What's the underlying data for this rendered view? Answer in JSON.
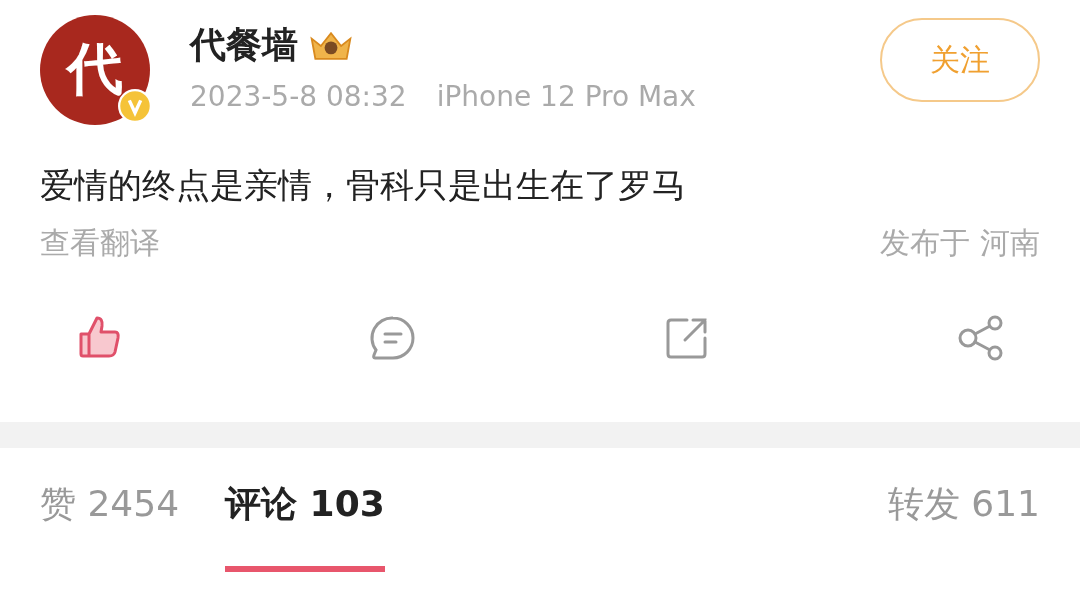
{
  "author": {
    "avatar_text": "代",
    "name": "代餐墙",
    "verified": true,
    "time": "2023-5-8 08:32",
    "device": "iPhone 12 Pro Max"
  },
  "follow_button": {
    "label": "关注"
  },
  "post": {
    "text": "爱情的终点是亲情，骨科只是出生在了罗马",
    "translate": "查看翻译",
    "location": "发布于 河南"
  },
  "actions": [
    {
      "kind": "like",
      "selected": true
    },
    {
      "kind": "comment",
      "selected": false
    },
    {
      "kind": "repost",
      "selected": false
    },
    {
      "kind": "share",
      "selected": false
    }
  ],
  "tabs": [
    {
      "label": "赞 2454",
      "selected": false
    },
    {
      "label": "评论 103",
      "selected": true
    },
    {
      "label": "转发 611",
      "selected": false
    }
  ]
}
